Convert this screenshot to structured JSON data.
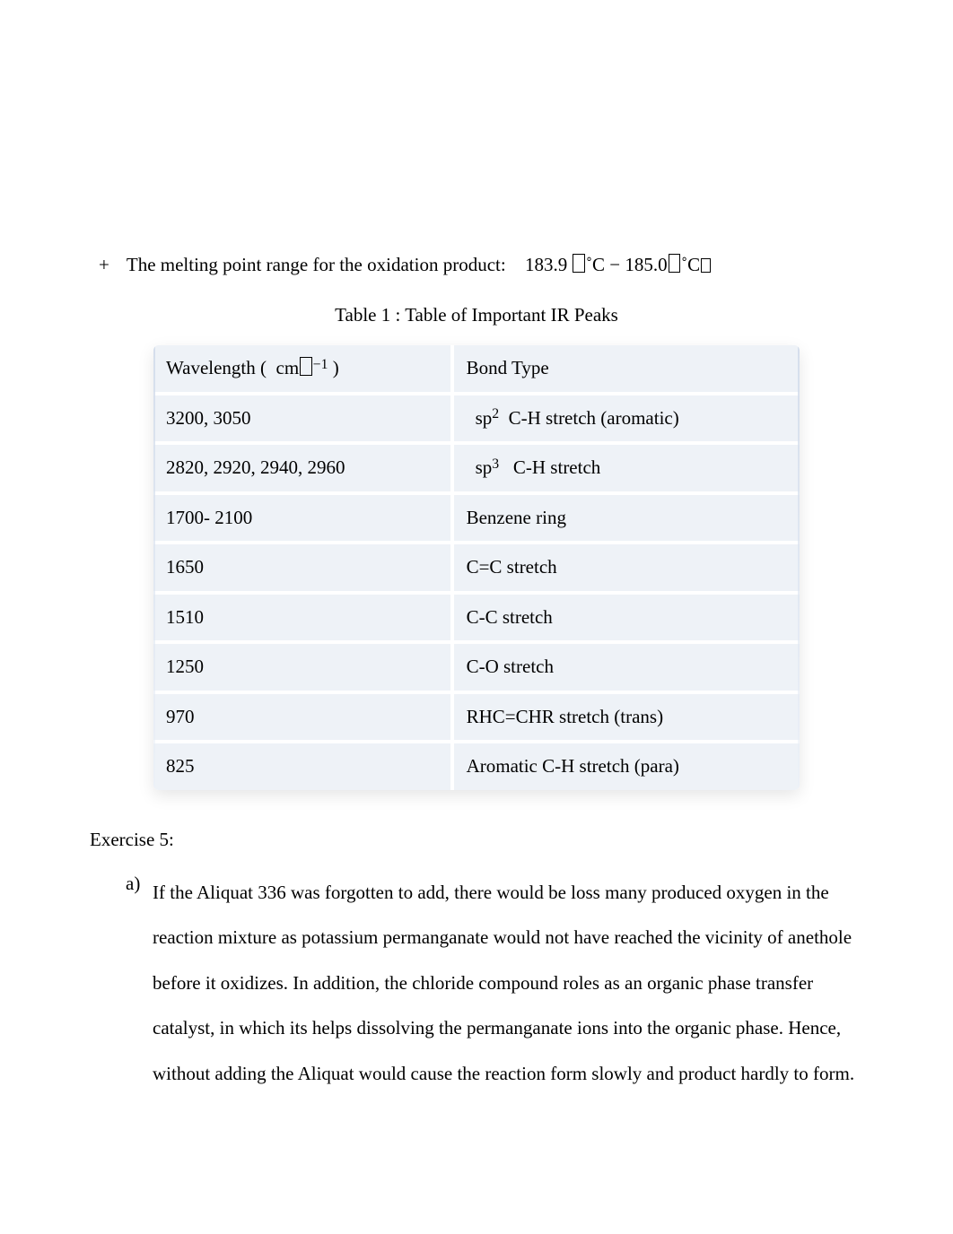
{
  "mp": {
    "bullet": "+",
    "text": "The melting point range for the oxidation product:",
    "value_html": "183.9 <span class='box'></span>˚C − 185.0<span class='box'></span>˚C<span class='box sup'></span>"
  },
  "table": {
    "caption": "Table 1 : Table of Important IR Peaks",
    "headers": {
      "wavelength_html": "Wavelength (&nbsp;&nbsp;cm<span class='box'></span><span class='neg-sup'>−1</span>&nbsp;)",
      "bond": "Bond Type"
    },
    "rows": [
      {
        "w": "3200, 3050",
        "b_html": "<span class='pad-bond'></span>sp<span class='sup'>2</span>&nbsp; C-H stretch (aromatic)"
      },
      {
        "w": "2820, 2920, 2940, 2960",
        "b_html": "<span class='pad-bond'></span>sp<span class='sup'>3</span>&nbsp;&nbsp; C-H stretch"
      },
      {
        "w": "1700- 2100",
        "b": "Benzene ring"
      },
      {
        "w": "1650",
        "b": "C=C stretch"
      },
      {
        "w": "1510",
        "b": "C-C stretch"
      },
      {
        "w": "1250",
        "b": "C-O stretch"
      },
      {
        "w": "970",
        "b": "RHC=CHR stretch (trans)"
      },
      {
        "w": "825",
        "b": "Aromatic C-H stretch (para)"
      }
    ]
  },
  "exercise": {
    "heading": "Exercise 5:",
    "item_marker": "a)",
    "item_text": "If the Aliquat 336 was forgotten to add, there would be loss many produced oxygen in the reaction mixture as potassium permanganate would not have reached the vicinity of anethole before it oxidizes. In addition, the chloride compound roles as an organic phase transfer catalyst, in which its helps dissolving the permanganate ions into the organic phase. Hence, without adding the Aliquat would cause the reaction form slowly and product hardly to form."
  }
}
